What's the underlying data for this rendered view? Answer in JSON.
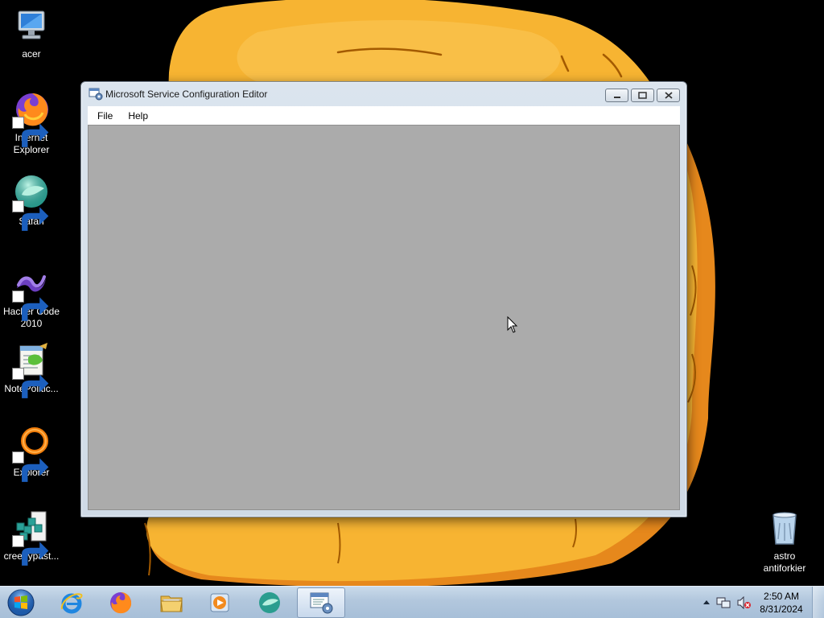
{
  "desktop": {
    "icons": [
      {
        "label": "acer",
        "icon": "computer-icon"
      },
      {
        "label": "Internet Explorer",
        "icon": "firefox-icon"
      },
      {
        "label": "Safari",
        "icon": "safari-icon"
      },
      {
        "label": "Hacker Code 2010",
        "icon": "visual-studio-icon"
      },
      {
        "label": "NotePolitic...",
        "icon": "notepad-icon"
      },
      {
        "label": "Explorer",
        "icon": "orange-ring-icon"
      },
      {
        "label": "creepypast...",
        "icon": "registry-editor-icon"
      },
      {
        "label": "astro antiforkier",
        "icon": "recycle-bin-icon"
      }
    ]
  },
  "window": {
    "title": "Microsoft Service Configuration Editor",
    "menu": [
      "File",
      "Help"
    ],
    "client_color": "#ababab"
  },
  "taskbar": {
    "items": [
      "start-orb",
      "internet-explorer-icon",
      "firefox-icon",
      "file-explorer-icon",
      "media-player-icon",
      "safari-icon",
      "service-config-editor-icon"
    ],
    "clock": {
      "time": "2:50 AM",
      "date": "8/31/2024"
    },
    "tray_icons": [
      "show-hidden-icons-arrow",
      "network-icon",
      "volume-muted-icon"
    ]
  },
  "colors": {
    "taskbar": "#b8cce0",
    "wallpaper_bg": "#000000",
    "wallpaper_accent": "#f6a623"
  }
}
